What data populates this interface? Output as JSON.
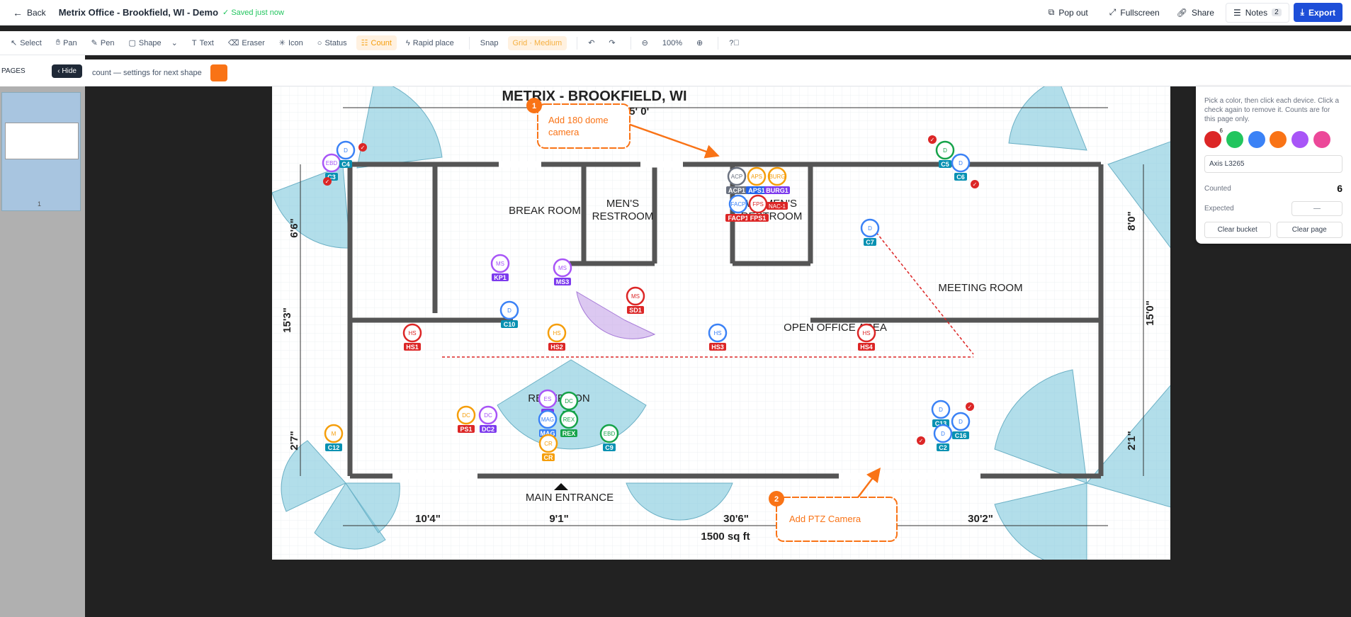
{
  "topbar": {
    "back_label": "Back",
    "doc_title": "Metrix Office - Brookfield, WI - Demo",
    "save_status": "✓ Saved just now",
    "popout_label": "Pop out",
    "fullscreen_label": "Fullscreen",
    "share_label": "Share",
    "notes_label": "Notes",
    "notes_count": "2",
    "export_label": "Export"
  },
  "toolbar": {
    "tools": [
      "Select",
      "Pan",
      "Pen",
      "Shape",
      "Text",
      "Eraser",
      "Icon",
      "Status",
      "Count",
      "Rapid place"
    ],
    "snap_label": "Snap",
    "grid_label": "Grid · Medium",
    "zoom_label": "100%"
  },
  "sidebar": {
    "title": "PAGES",
    "hide_label": "Hide",
    "page_number": "1"
  },
  "countbar": {
    "hint": "count — settings for next shape",
    "swatch_color": "#f97316"
  },
  "panel": {
    "instructions": "Pick a color, then click each device. Click a check again to remove it. Counts are for this page only.",
    "swatch_colors": [
      "#dc2626",
      "#22c55e",
      "#3b82f6",
      "#f97316",
      "#a855f7",
      "#ec4899"
    ],
    "first_swatch_count": "6",
    "bucket_name": "Axis L3265",
    "counted_label": "Counted",
    "counted_value": "6",
    "expected_label": "Expected",
    "expected_value": "—",
    "clear_bucket_label": "Clear bucket",
    "clear_page_label": "Clear page"
  },
  "plan": {
    "title": "METRIX - BROOKFIELD, WI",
    "rooms": [
      "BREAK ROOM",
      "MEN'S",
      "RESTROOM",
      "WOMEN'S",
      "RESTROOM",
      "MEETING ROOM",
      "OPEN OFFICE AREA",
      "RECEPTION",
      "MAIN ENTRANCE"
    ],
    "dims": {
      "top": "15' 0'",
      "left1": "6'6\"",
      "left2": "15'3\"",
      "left3": "2'7\"",
      "right1": "8'0\"",
      "right2": "15'0\"",
      "right3": "2'1\"",
      "bottom": [
        "10'4\"",
        "9'1\"",
        "30'6\"",
        "30'2\""
      ],
      "area": "1500 sq ft"
    },
    "notes": [
      {
        "number": "1",
        "text1": "Add 180 dome",
        "text2": "camera"
      },
      {
        "number": "2",
        "text1": "Add PTZ Camera",
        "text2": ""
      }
    ],
    "devices": [
      "C3",
      "C4",
      "C5",
      "C6",
      "C7",
      "KP1",
      "MS3",
      "SD1",
      "C10",
      "HS1",
      "HS2",
      "HS3",
      "HS4",
      "ACP1",
      "APS1",
      "BURG1",
      "NAC-1",
      "FACP1",
      "FPS1",
      "PS1",
      "DC2",
      "ES",
      "DC",
      "MAG",
      "REX",
      "CR",
      "C9",
      "C12",
      "C13",
      "C16",
      "C2"
    ],
    "device_inner": {
      "ms": "MS",
      "d": "D",
      "hs": "HS",
      "acp": "ACP",
      "aps": "APS",
      "burg": "BURG",
      "facp": "FACP",
      "fps": "FPS",
      "dc": "DC",
      "es": "ES",
      "mag": "MAG",
      "rex": "REX",
      "cr": "CR",
      "m": "M",
      "ebd": "EBD",
      "edl": "EDL",
      "d1": "D1"
    }
  }
}
